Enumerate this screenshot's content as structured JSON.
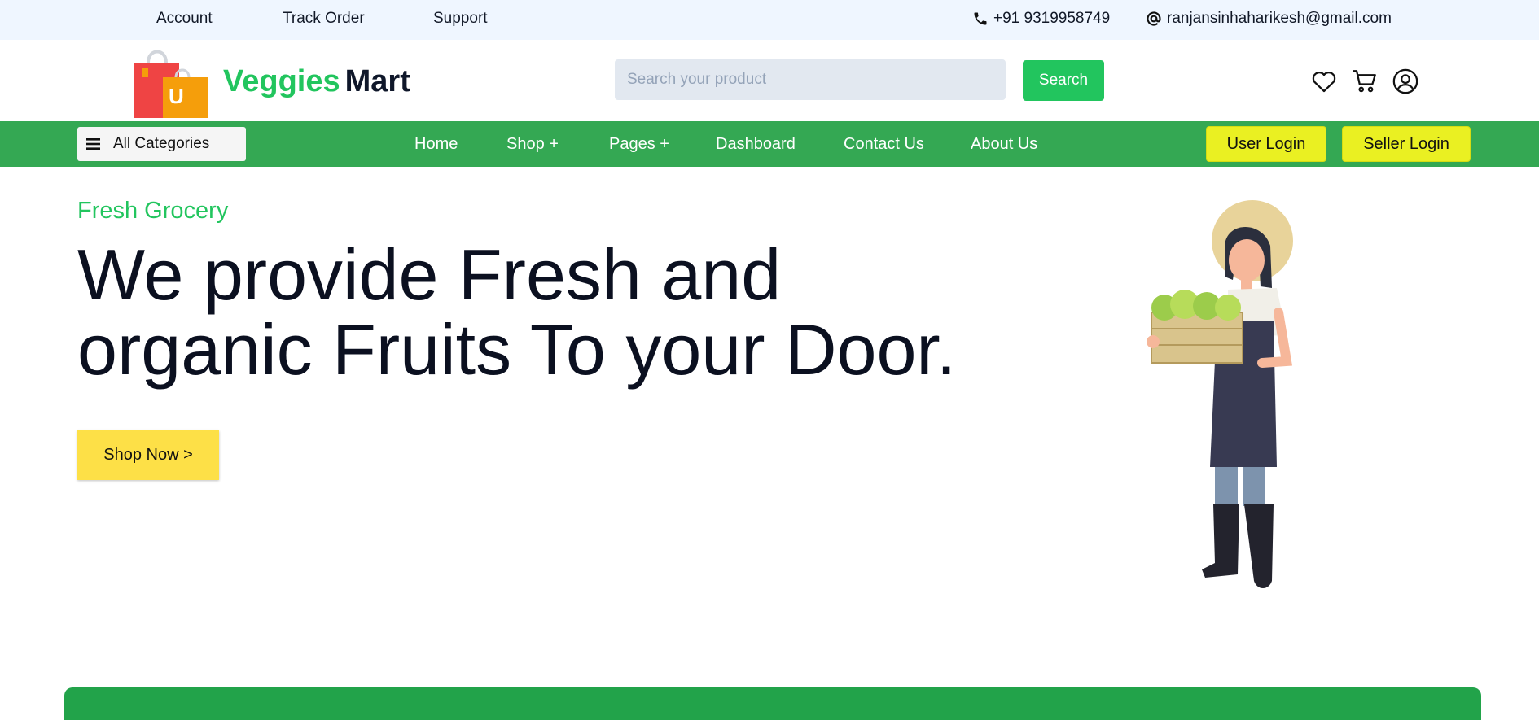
{
  "topbar": {
    "links": [
      "Account",
      "Track Order",
      "Support"
    ],
    "phone": "+91 9319958749",
    "email": "ranjansinhaharikesh@gmail.com"
  },
  "header": {
    "logo_badge": "U",
    "logo_word_1": "Veggies",
    "logo_word_2": "Mart",
    "search_placeholder": "Search your product",
    "search_button": "Search",
    "icons": [
      "heart-icon",
      "cart-icon",
      "user-icon"
    ]
  },
  "nav": {
    "all_categories": "All Categories",
    "links": [
      "Home",
      "Shop +",
      "Pages +",
      "Dashboard",
      "Contact Us",
      "About Us"
    ],
    "user_login": "User Login",
    "seller_login": "Seller Login"
  },
  "hero": {
    "eyebrow": "Fresh Grocery",
    "headline_line1": "We provide Fresh and",
    "headline_line2": "organic Fruits To your Door.",
    "cta": "Shop Now >"
  },
  "colors": {
    "brand_green": "#22c55e",
    "nav_green": "#34a853",
    "login_yellow": "#eaf022",
    "cta_yellow": "#fde047",
    "topbar_bg": "#eff6ff"
  }
}
